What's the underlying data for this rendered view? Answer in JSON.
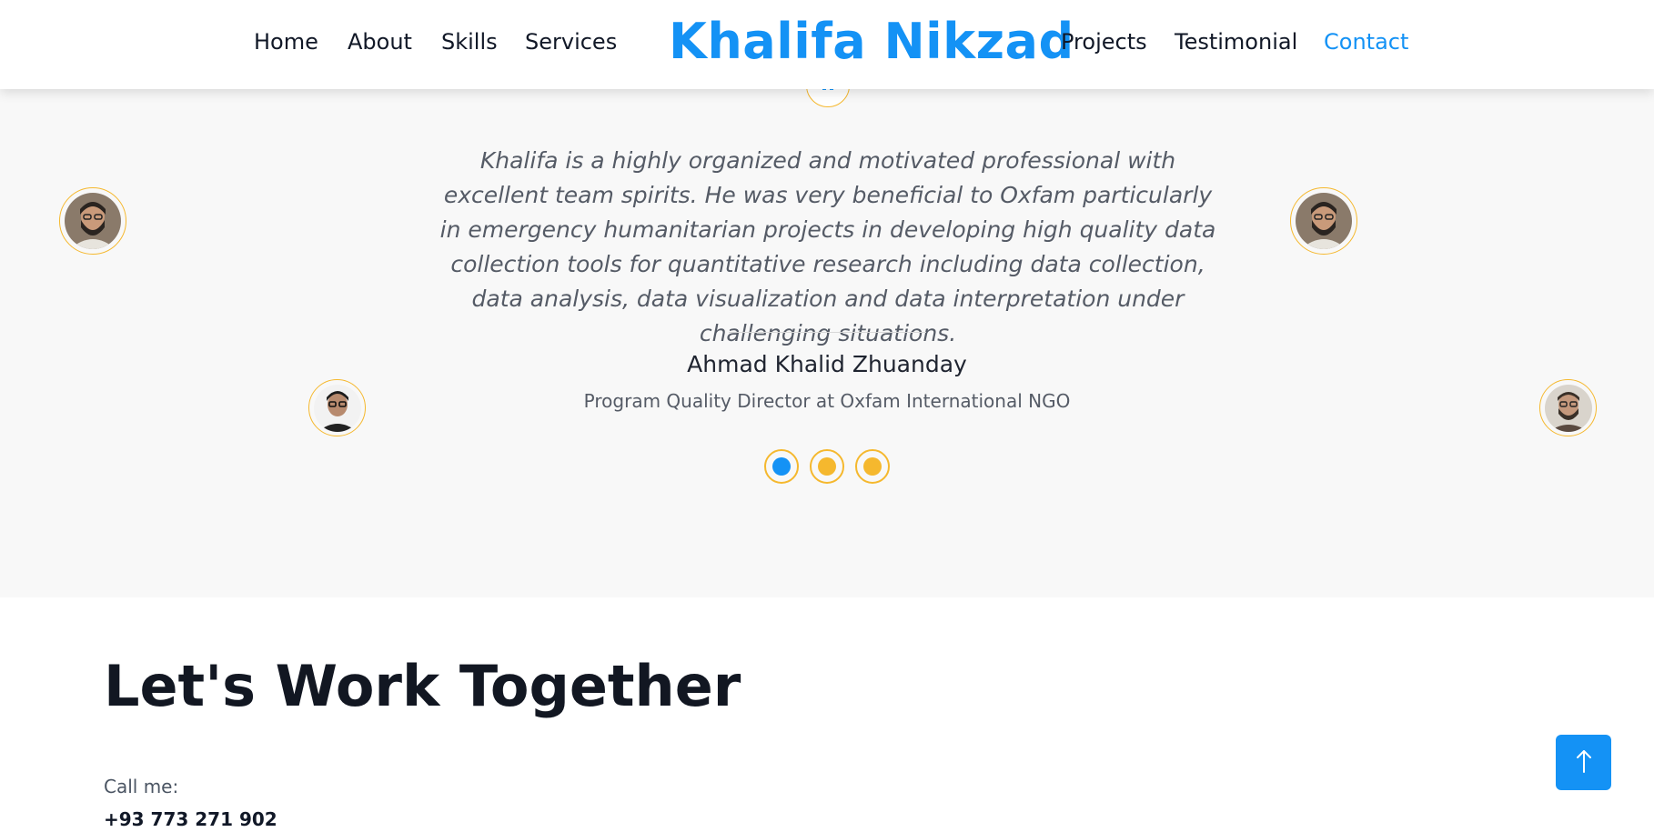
{
  "header": {
    "brand": "Khalifa Nikzad",
    "nav_left": [
      {
        "label": "Home"
      },
      {
        "label": "About"
      },
      {
        "label": "Skills"
      },
      {
        "label": "Services"
      }
    ],
    "nav_right": [
      {
        "label": "Projects"
      },
      {
        "label": "Testimonial"
      },
      {
        "label": "Contact",
        "active": true
      }
    ]
  },
  "testimonial": {
    "quote": "Khalifa is a highly organized and motivated professional with excellent team spirits. He was very beneficial to Oxfam particularly in emergency humanitarian projects in developing high quality data collection tools for quantitative research including data collection, data analysis, data visualization and data interpretation under challenging situations.",
    "name": "Ahmad Khalid Zhuanday",
    "role": "Program Quality Director at Oxfam International NGO",
    "slides": 3,
    "active_slide": 1
  },
  "contact": {
    "title": "Let's Work Together",
    "call_label": "Call me:",
    "phone": "+93 773 271 902"
  },
  "colors": {
    "accent": "#1492f5",
    "ring": "#f5b82e",
    "section_bg": "#f8f8f8"
  },
  "icons": {
    "quote": "quote-icon",
    "back_to_top": "arrow-up-icon"
  }
}
